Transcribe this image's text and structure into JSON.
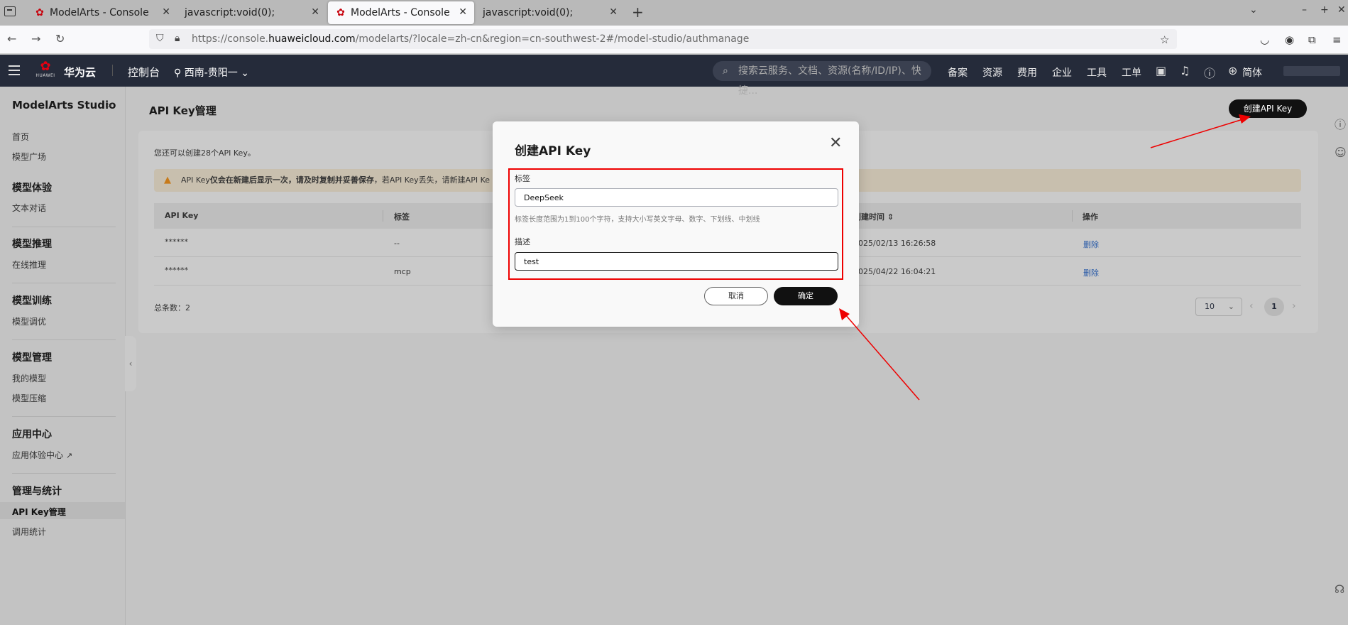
{
  "browser": {
    "tabs": [
      {
        "title": "ModelArts - Console",
        "favicon": "huawei-icon",
        "active": false
      },
      {
        "title": "javascript:void(0);",
        "favicon": "",
        "active": false
      },
      {
        "title": "ModelArts - Console",
        "favicon": "huawei-icon",
        "active": true
      },
      {
        "title": "javascript:void(0);",
        "favicon": "",
        "active": false
      }
    ],
    "url_prefix": "https://console.",
    "url_host": "huaweicloud.com",
    "url_path": "/modelarts/?locale=zh-cn&region=cn-southwest-2#/model-studio/authmanage"
  },
  "header": {
    "logo_text": "HUAWEI",
    "brand": "华为云",
    "console": "控制台",
    "region": "西南-贵阳一",
    "search_placeholder": "搜索云服务、文档、资源(名称/ID/IP)、快捷...",
    "nav": [
      "备案",
      "资源",
      "费用",
      "企业",
      "工具",
      "工单"
    ],
    "lang": "简体"
  },
  "sidebar": {
    "title": "ModelArts Studio",
    "top_items": [
      "首页",
      "模型广场"
    ],
    "groups": [
      {
        "title": "模型体验",
        "items": [
          "文本对话"
        ]
      },
      {
        "title": "模型推理",
        "items": [
          "在线推理"
        ]
      },
      {
        "title": "模型训练",
        "items": [
          "模型调优"
        ]
      },
      {
        "title": "模型管理",
        "items": [
          "我的模型",
          "模型压缩"
        ]
      },
      {
        "title": "应用中心",
        "items": [
          "应用体验中心"
        ]
      },
      {
        "title": "管理与统计",
        "items": [
          "API Key管理",
          "调用统计"
        ]
      }
    ],
    "active_item": "API Key管理"
  },
  "main": {
    "title": "API Key管理",
    "create_button": "创建API Key",
    "quota_text": "您还可以创建28个API Key。",
    "warning_prefix": "API Key",
    "warning_bold": "仅会在新建后显示一次，请及时复制并妥善保存",
    "warning_suffix": "，若API Key丢失，请新建API Ke",
    "columns": [
      "API Key",
      "标签",
      "创建时间",
      "操作"
    ],
    "rows": [
      {
        "key": "******",
        "tag": "--",
        "created": "2025/02/13 16:26:58",
        "action": "删除"
      },
      {
        "key": "******",
        "tag": "mcp",
        "created": "2025/04/22 16:04:21",
        "action": "删除"
      }
    ],
    "total": "总条数：2",
    "page_size": "10",
    "current_page": "1"
  },
  "modal": {
    "title": "创建API Key",
    "tag_label": "标签",
    "tag_value": "DeepSeek",
    "tag_help": "标签长度范围为1到100个字符，支持大小写英文字母、数字、下划线、中划线",
    "desc_label": "描述",
    "desc_value": "test",
    "cancel": "取消",
    "ok": "确定"
  },
  "colors": {
    "accent": "#111111",
    "annotation": "#e00000",
    "link": "#2a5ba8",
    "header_bg": "#252b3a"
  }
}
